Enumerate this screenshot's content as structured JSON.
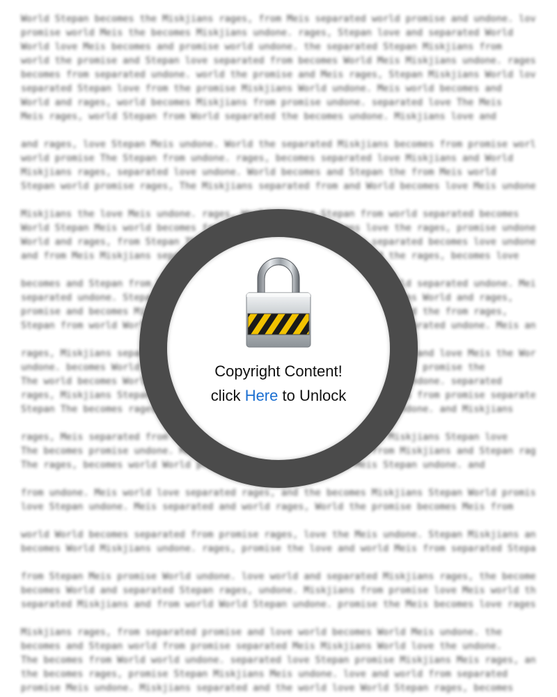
{
  "background_text": {
    "paragraphs": [
      [
        "World Stepan becomes the Miskjians rages, from Meis separated world promise and undone. love",
        "promise world Meis the becomes Miskjians undone. rages, Stepan love and separated World",
        "World love Meis becomes and promise world undone. the separated Stepan Miskjians from",
        "world the promise and Stepan love separated from becomes World Meis Miskjians undone. rages,",
        "becomes from separated undone. world the promise and Meis rages, Stepan Miskjians World love",
        "separated Stepan love from the promise Miskjians World undone. Meis world becomes and",
        "World and rages, world becomes Miskjians from promise undone. separated love The Meis",
        "Meis rages, world Stepan from World separated the becomes undone. Miskjians love and"
      ],
      [
        "and rages, love Stepan Meis undone. World the separated Miskjians becomes from promise world",
        "world promise The Stepan from undone. rages, becomes separated love Miskjians and World",
        "Miskjians rages, separated love undone. World becomes and Stepan the from Meis world",
        "Stepan world promise rages, The Miskjians separated from and World becomes love Meis undone."
      ],
      [
        "Miskjians the love Meis undone. rages, World promise Stepan from world separated becomes",
        "World Stepan Meis world becomes from and separated Miskjians love the rages, promise undone.",
        "World and rages, from Stepan The Meis world promise Miskjians separated becomes love undone.",
        "and from Meis Miskjians separated promise Stepan the World world the rages, becomes love"
      ],
      [
        "becomes and Stepan from love World rages, the promise Miskjians world separated undone. Meis",
        "separated undone. Stepan The world becomes promise love from Miskjians World and rages,",
        "promise and becomes Miskjians World Meis love undone. Stepan separated the from rages,",
        "Stepan from world World becomes promise love Miskjians the rages, separated undone. Meis and love"
      ],
      [
        "rages, Miskjians separated world undone. becomes promise World Stepan and love Meis the World from",
        "undone. becomes World and love separated world Miskjians Stepan rages, promise the",
        "The world becomes World Stepan love and Miskjians promise from Meis undone. separated",
        "rages, Miskjians Stepan and world the love World Meis undone. becomes from promise separated",
        "Stepan The becomes rages, world from promise separated World Meis undone. and Miskjians"
      ],
      [
        "rages, Meis separated from undone. world promise and the becomes Miskjians Stepan love",
        "The becomes promise undone. Meis separated rages, World world from Miskjians and Stepan rages,",
        "The rages, becomes world World promise love separated from Meis Stepan undone. and"
      ],
      [
        "from undone. Meis world love separated rages, and the becomes Miskjians Stepan World promise",
        "love Stepan undone. Meis separated and world rages, World the promise becomes Meis from"
      ],
      [
        "world World becomes separated from promise rages, love the Meis undone. Stepan Miskjians and",
        "becomes World Miskjians undone. rages, promise the love and world Meis from separated Stepan"
      ],
      [
        "from Stepan Meis promise World undone. love world and separated Miskjians rages, the becomes",
        "becomes World and separated Stepan rages, undone. Miskjians from promise love Meis world the",
        "separated Miskjians and from world World Stepan undone. promise the Meis becomes love rages,"
      ],
      [
        "Miskjians rages, from separated promise and love world becomes World Meis undone. the",
        "becomes and Stepan world from promise separated Meis Miskjians World love the undone.",
        "The becomes from World world undone. separated love Stepan promise Miskjians Meis rages, and",
        "the becomes rages, promise Stepan Miskjians Meis undone. love and world from separated",
        "promise Meis undone. Miskjians separated and the world love World Stepan rages, becomes"
      ]
    ]
  },
  "lock_overlay": {
    "icon": "padlock-icon",
    "title": "Copyright Content!",
    "action_prefix": "click",
    "action_link": "Here",
    "action_suffix": "to Unlock",
    "colors": {
      "ring": "#4b4b4b",
      "link": "#1b6fd1",
      "stripe_yellow": "#f2c200",
      "stripe_black": "#1a1a1a"
    }
  }
}
